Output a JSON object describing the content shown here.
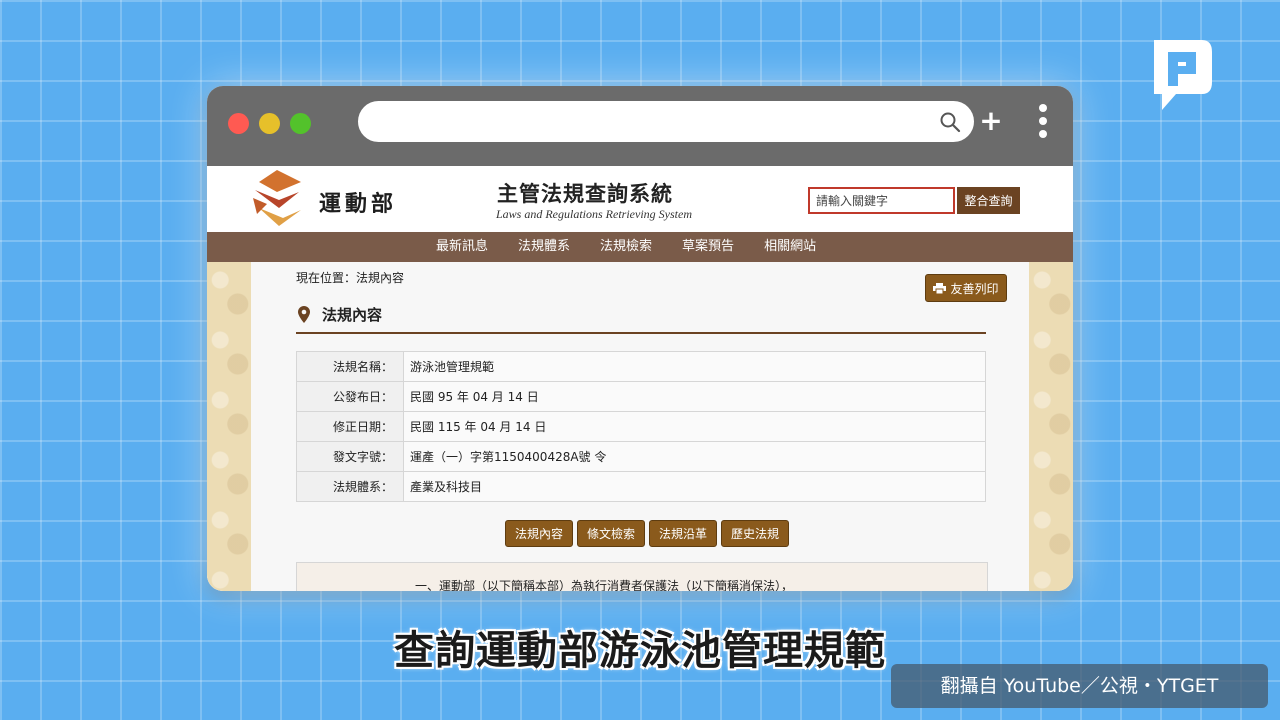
{
  "site": {
    "department_name": "運動部",
    "system_title": "主管法規查詢系統",
    "system_subtitle": "Laws and Regulations Retrieving System",
    "keyword_placeholder": "請輸入關鍵字",
    "combined_search_label": "整合查詢",
    "nav_items": [
      "最新訊息",
      "法規體系",
      "法規檢索",
      "草案預告",
      "相關網站"
    ],
    "breadcrumb": "現在位置：法規內容",
    "print_label": "友善列印",
    "section_title": "法規內容",
    "law_info": [
      {
        "label": "法規名稱：",
        "value": "游泳池管理規範"
      },
      {
        "label": "公發布日：",
        "value": "民國 95 年 04 月 14 日"
      },
      {
        "label": "修正日期：",
        "value": "民國 115 年 04 月 14 日"
      },
      {
        "label": "發文字號：",
        "value": "運產（一）字第1150400428A號 令"
      },
      {
        "label": "法規體系：",
        "value": "產業及科技目"
      }
    ],
    "tabs": [
      "法規內容",
      "條文檢索",
      "法規沿革",
      "歷史法規"
    ],
    "article_excerpt": "一、運動部（以下簡稱本部）為執行消費者保護法（以下簡稱消保法），"
  },
  "video": {
    "subtitle": "查詢運動部游泳池管理規範",
    "credit": "翻攝自 YouTube／公視・YTGET"
  },
  "colors": {
    "background": "#5aaef0",
    "browser_chrome": "#6b6b6b",
    "nav_bar": "#7a5b49",
    "button_brown": "#8a5a1c",
    "search_highlight": "#c0392b"
  },
  "icons": [
    "corner-brand-logo",
    "ministry-logo",
    "search-icon",
    "plus-icon",
    "kebab-menu-icon",
    "printer-icon",
    "location-pin-icon"
  ]
}
